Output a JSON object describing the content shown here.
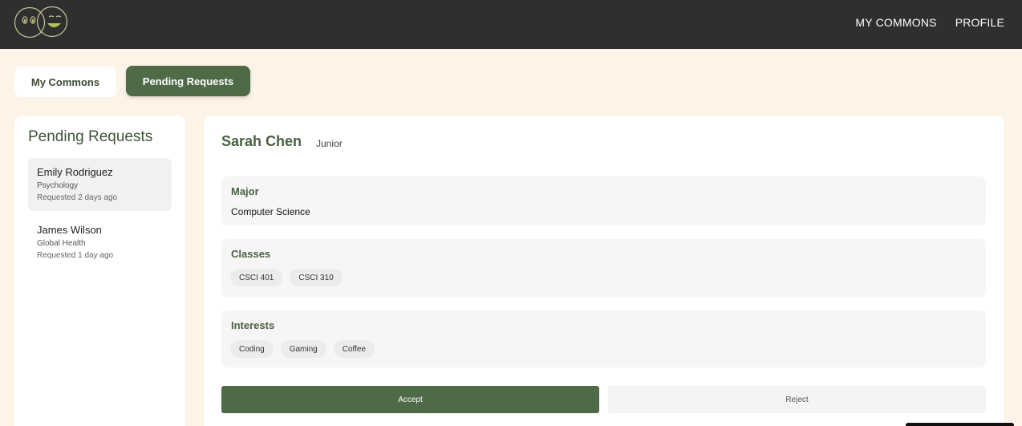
{
  "header": {
    "logo_icon": "two-smiley-faces-logo",
    "nav": [
      {
        "label": "MY COMMONS"
      },
      {
        "label": "PROFILE"
      }
    ]
  },
  "tabs": [
    {
      "label": "My Commons",
      "active": false
    },
    {
      "label": "Pending Requests",
      "active": true
    }
  ],
  "sidebar": {
    "title": "Pending Requests",
    "requests": [
      {
        "name": "Emily Rodriguez",
        "major": "Psychology",
        "requested": "Requested 2 days ago",
        "selected": true
      },
      {
        "name": "James Wilson",
        "major": "Global Health",
        "requested": "Requested 1 day ago",
        "selected": false
      }
    ]
  },
  "profile": {
    "name": "Sarah Chen",
    "year": "Junior",
    "major_label": "Major",
    "major": "Computer Science",
    "classes_label": "Classes",
    "classes": [
      "CSCI 401",
      "CSCI 310"
    ],
    "interests_label": "Interests",
    "interests": [
      "Coding",
      "Gaming",
      "Coffee"
    ]
  },
  "actions": {
    "accept_label": "Accept",
    "reject_label": "Reject"
  },
  "colors": {
    "accent": "#4f6a47",
    "header_bg": "#2f2f2f",
    "page_bg": "#fdf3e6"
  }
}
